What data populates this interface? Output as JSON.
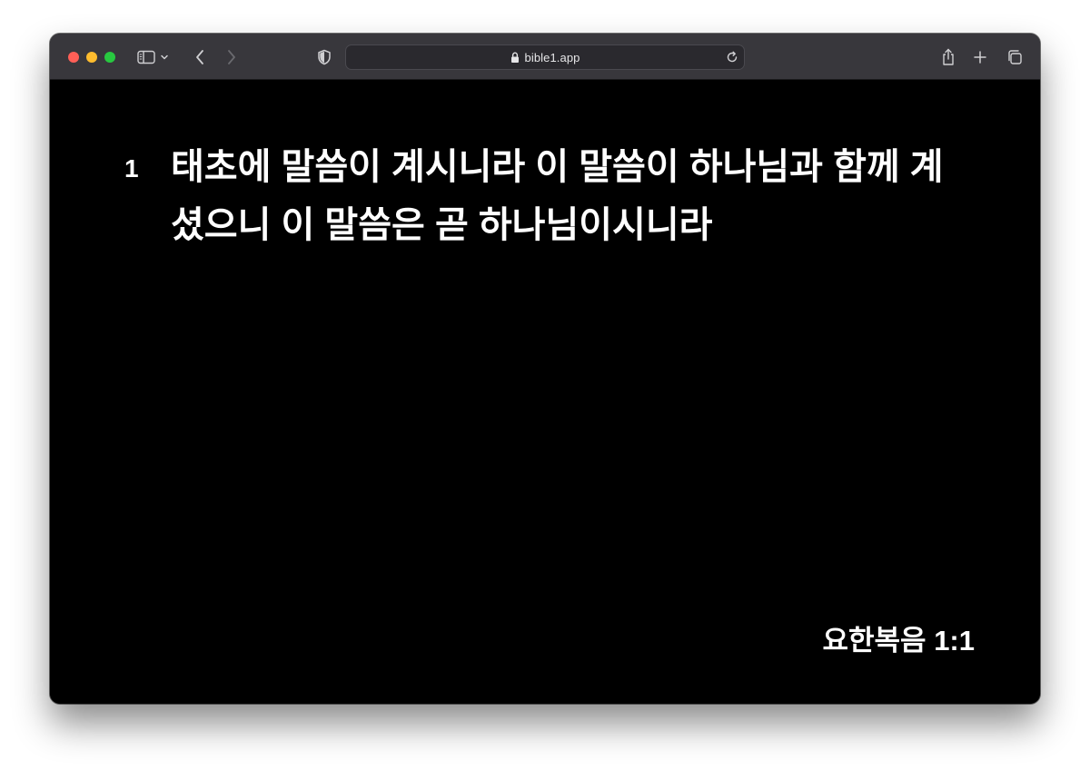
{
  "browser": {
    "url": "bible1.app",
    "icons": {
      "sidebar": "sidebar-toggle-icon",
      "chevron": "chevron-down-icon",
      "back": "back-arrow-icon",
      "forward": "forward-arrow-icon",
      "privacy": "shield-icon",
      "lock": "lock-icon",
      "reload": "reload-icon",
      "share": "share-icon",
      "new_tab": "plus-icon",
      "tabs": "tab-overview-icon"
    },
    "colors": {
      "close": "#ff5f57",
      "minimize": "#febc2e",
      "zoom": "#28c840",
      "toolbar": "#38373c"
    }
  },
  "slide": {
    "verse_number": "1",
    "verse_text": "태초에 말씀이 계시니라 이 말씀이 하나님과 함께 계셨으니 이 말씀은 곧 하나님이시니라",
    "reference": "요한복음 1:1",
    "colors": {
      "background": "#000000",
      "text": "#ffffff"
    }
  }
}
